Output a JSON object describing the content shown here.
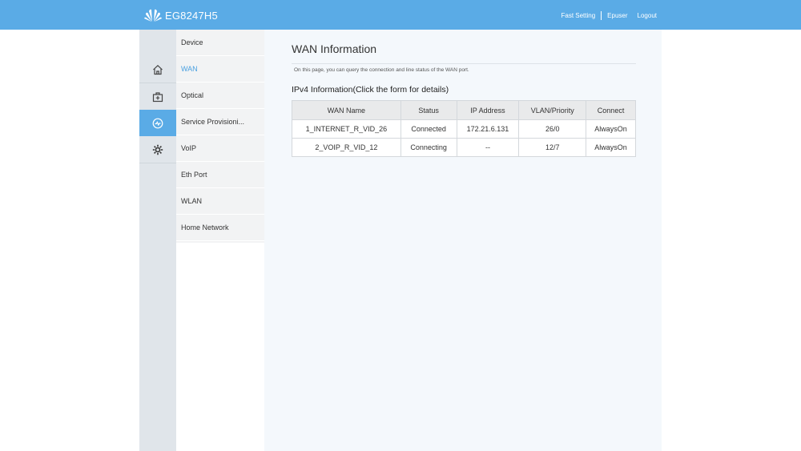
{
  "header": {
    "brand": "EG8247H5",
    "links": {
      "fast_setting": "Fast Setting",
      "user": "Epuser",
      "logout": "Logout"
    }
  },
  "icon_nav": [
    "home-icon",
    "medkit-icon",
    "diagnose-icon",
    "gear-icon"
  ],
  "submenu": [
    "Device",
    "WAN",
    "Optical",
    "Service Provisioni...",
    "VoIP",
    "Eth Port",
    "WLAN",
    "Home Network"
  ],
  "main": {
    "title": "WAN Information",
    "description": "On this page, you can query the connection and line status of the WAN port.",
    "section_title": "IPv4 Information(Click the form for details)",
    "table": {
      "headers": [
        "WAN Name",
        "Status",
        "IP Address",
        "VLAN/Priority",
        "Connect"
      ],
      "rows": [
        [
          "1_INTERNET_R_VID_26",
          "Connected",
          "172.21.6.131",
          "26/0",
          "AlwaysOn"
        ],
        [
          "2_VOIP_R_VID_12",
          "Connecting",
          "--",
          "12/7",
          "AlwaysOn"
        ]
      ]
    }
  },
  "colors": {
    "accent": "#5aabe6",
    "active_text": "#4aa0e0"
  }
}
